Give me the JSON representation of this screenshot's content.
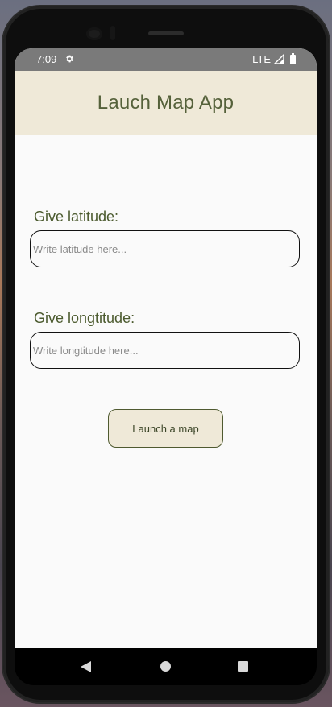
{
  "status_bar": {
    "time": "7:09",
    "network": "LTE",
    "settings_icon": "gear-icon",
    "signal_icon": "cell-signal-icon",
    "battery_icon": "battery-icon"
  },
  "app_bar": {
    "title": "Lauch Map App"
  },
  "latitude": {
    "label": "Give latitude:",
    "placeholder": "Write latitude here...",
    "value": ""
  },
  "longitude": {
    "label": "Give longtitude:",
    "placeholder": "Write longtitude here...",
    "value": ""
  },
  "launch_button": {
    "label": "Launch a map"
  },
  "nav": {
    "back_icon": "back-triangle-icon",
    "home_icon": "home-circle-icon",
    "recents_icon": "recents-square-icon"
  },
  "colors": {
    "app_bar_bg": "#efe9d8",
    "accent_text": "#55613a",
    "status_bar_bg": "#7a7a7a",
    "screen_bg": "#fafafa"
  }
}
